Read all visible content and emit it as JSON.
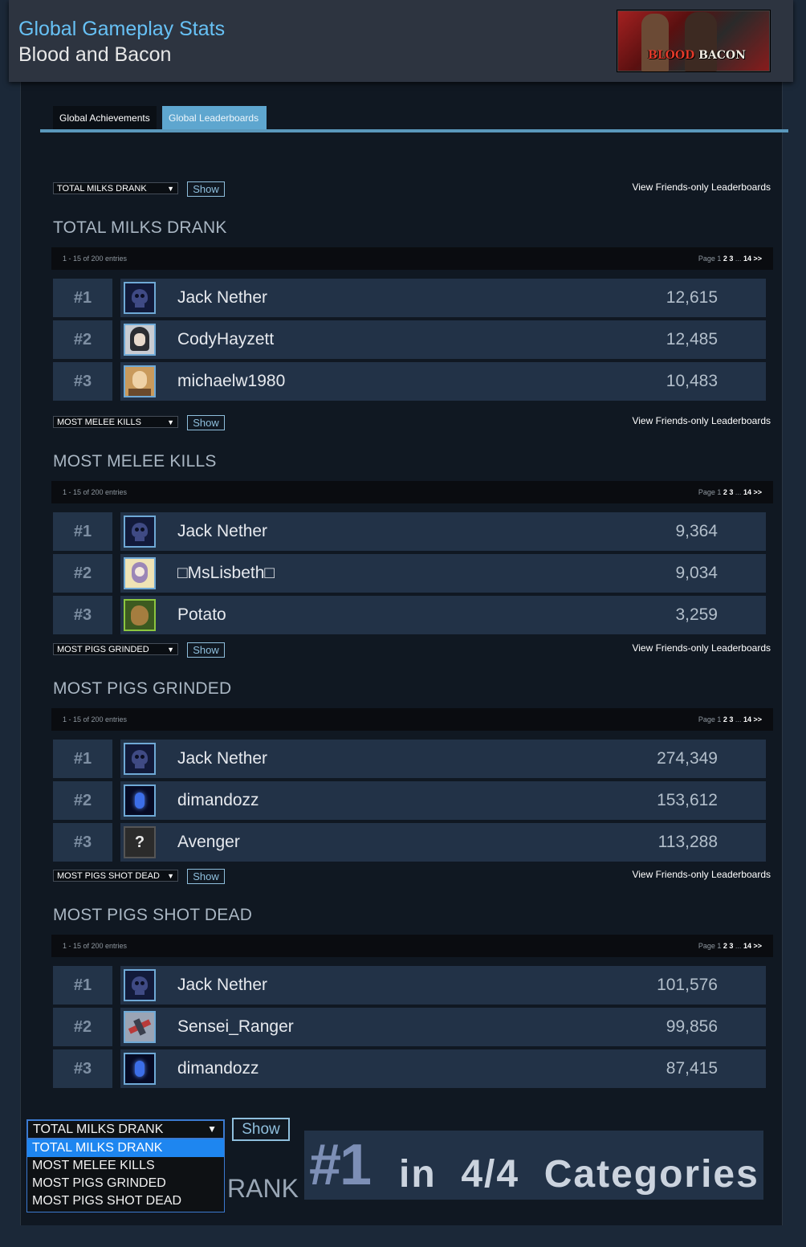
{
  "header": {
    "title": "Global Gameplay Stats",
    "game": "Blood and Bacon",
    "logo_text_a": "BLOOD",
    "logo_text_b": "BACON"
  },
  "tabs": [
    {
      "label": "Global Achievements",
      "active": false
    },
    {
      "label": "Global Leaderboards",
      "active": true
    }
  ],
  "leaderboards": [
    {
      "select_value": "TOTAL MILKS DRANK",
      "show_label": "Show",
      "friends_link": "View Friends-only Leaderboards",
      "title": "TOTAL MILKS DRANK",
      "entries_text": "1 - 15 of 200 entries",
      "pager_prefix": "Page 1",
      "pager_pages": [
        "2",
        "3"
      ],
      "pager_ellipsis": "...",
      "pager_last": "14",
      "pager_next": ">>",
      "rows": [
        {
          "rank": "#1",
          "name": "Jack Nether",
          "score": "12,615",
          "avatar": "skull-avatar"
        },
        {
          "rank": "#2",
          "name": "CodyHayzett",
          "score": "12,485",
          "avatar": "anime-girl-avatar"
        },
        {
          "rank": "#3",
          "name": "michaelw1980",
          "score": "10,483",
          "avatar": "man-avatar"
        }
      ]
    },
    {
      "select_value": "MOST MELEE KILLS",
      "show_label": "Show",
      "friends_link": "View Friends-only Leaderboards",
      "title": "MOST MELEE KILLS",
      "entries_text": "1 - 15 of 200 entries",
      "pager_prefix": "Page 1",
      "pager_pages": [
        "2",
        "3"
      ],
      "pager_ellipsis": "...",
      "pager_last": "14",
      "pager_next": ">>",
      "rows": [
        {
          "rank": "#1",
          "name": "Jack Nether",
          "score": "9,364",
          "avatar": "skull-avatar"
        },
        {
          "rank": "#2",
          "name": "□MsLisbeth□",
          "score": "9,034",
          "avatar": "anime-lisbeth-avatar"
        },
        {
          "rank": "#3",
          "name": "Potato",
          "score": "3,259",
          "avatar": "potato-avatar"
        }
      ]
    },
    {
      "select_value": "MOST PIGS GRINDED",
      "show_label": "Show",
      "friends_link": "View Friends-only Leaderboards",
      "title": "MOST PIGS GRINDED",
      "entries_text": "1 - 15 of 200 entries",
      "pager_prefix": "Page 1",
      "pager_pages": [
        "2",
        "3"
      ],
      "pager_ellipsis": "...",
      "pager_last": "14",
      "pager_next": ">>",
      "rows": [
        {
          "rank": "#1",
          "name": "Jack Nether",
          "score": "274,349",
          "avatar": "skull-avatar"
        },
        {
          "rank": "#2",
          "name": "dimandozz",
          "score": "153,612",
          "avatar": "blue-glow-avatar"
        },
        {
          "rank": "#3",
          "name": "Avenger",
          "score": "113,288",
          "avatar": "question-mark-avatar"
        }
      ]
    },
    {
      "select_value": "MOST PIGS SHOT DEAD",
      "show_label": "Show",
      "friends_link": "View Friends-only Leaderboards",
      "title": "MOST PIGS SHOT DEAD",
      "entries_text": "1 - 15 of 200 entries",
      "pager_prefix": "Page 1",
      "pager_pages": [
        "2",
        "3"
      ],
      "pager_ellipsis": "...",
      "pager_last": "14",
      "pager_next": ">>",
      "rows": [
        {
          "rank": "#1",
          "name": "Jack Nether",
          "score": "101,576",
          "avatar": "skull-avatar"
        },
        {
          "rank": "#2",
          "name": "Sensei_Ranger",
          "score": "99,856",
          "avatar": "jet-avatar"
        },
        {
          "rank": "#3",
          "name": "dimandozz",
          "score": "87,415",
          "avatar": "blue-glow-avatar"
        }
      ]
    }
  ],
  "bottom": {
    "select_value": "TOTAL MILKS DRANK",
    "options": [
      "TOTAL MILKS DRANK",
      "MOST MELEE KILLS",
      "MOST PIGS GRINDED",
      "MOST PIGS SHOT DEAD"
    ],
    "selected_index": 0,
    "show_label": "Show",
    "rank_label": "RANK",
    "banner_number": "#1",
    "banner_text": "in  4/4  Categories"
  },
  "colors": {
    "page_bg": "#1b2838",
    "accent_blue": "#67c1f5",
    "active_tab": "#5ea6cf",
    "row_bg": "#223247"
  }
}
